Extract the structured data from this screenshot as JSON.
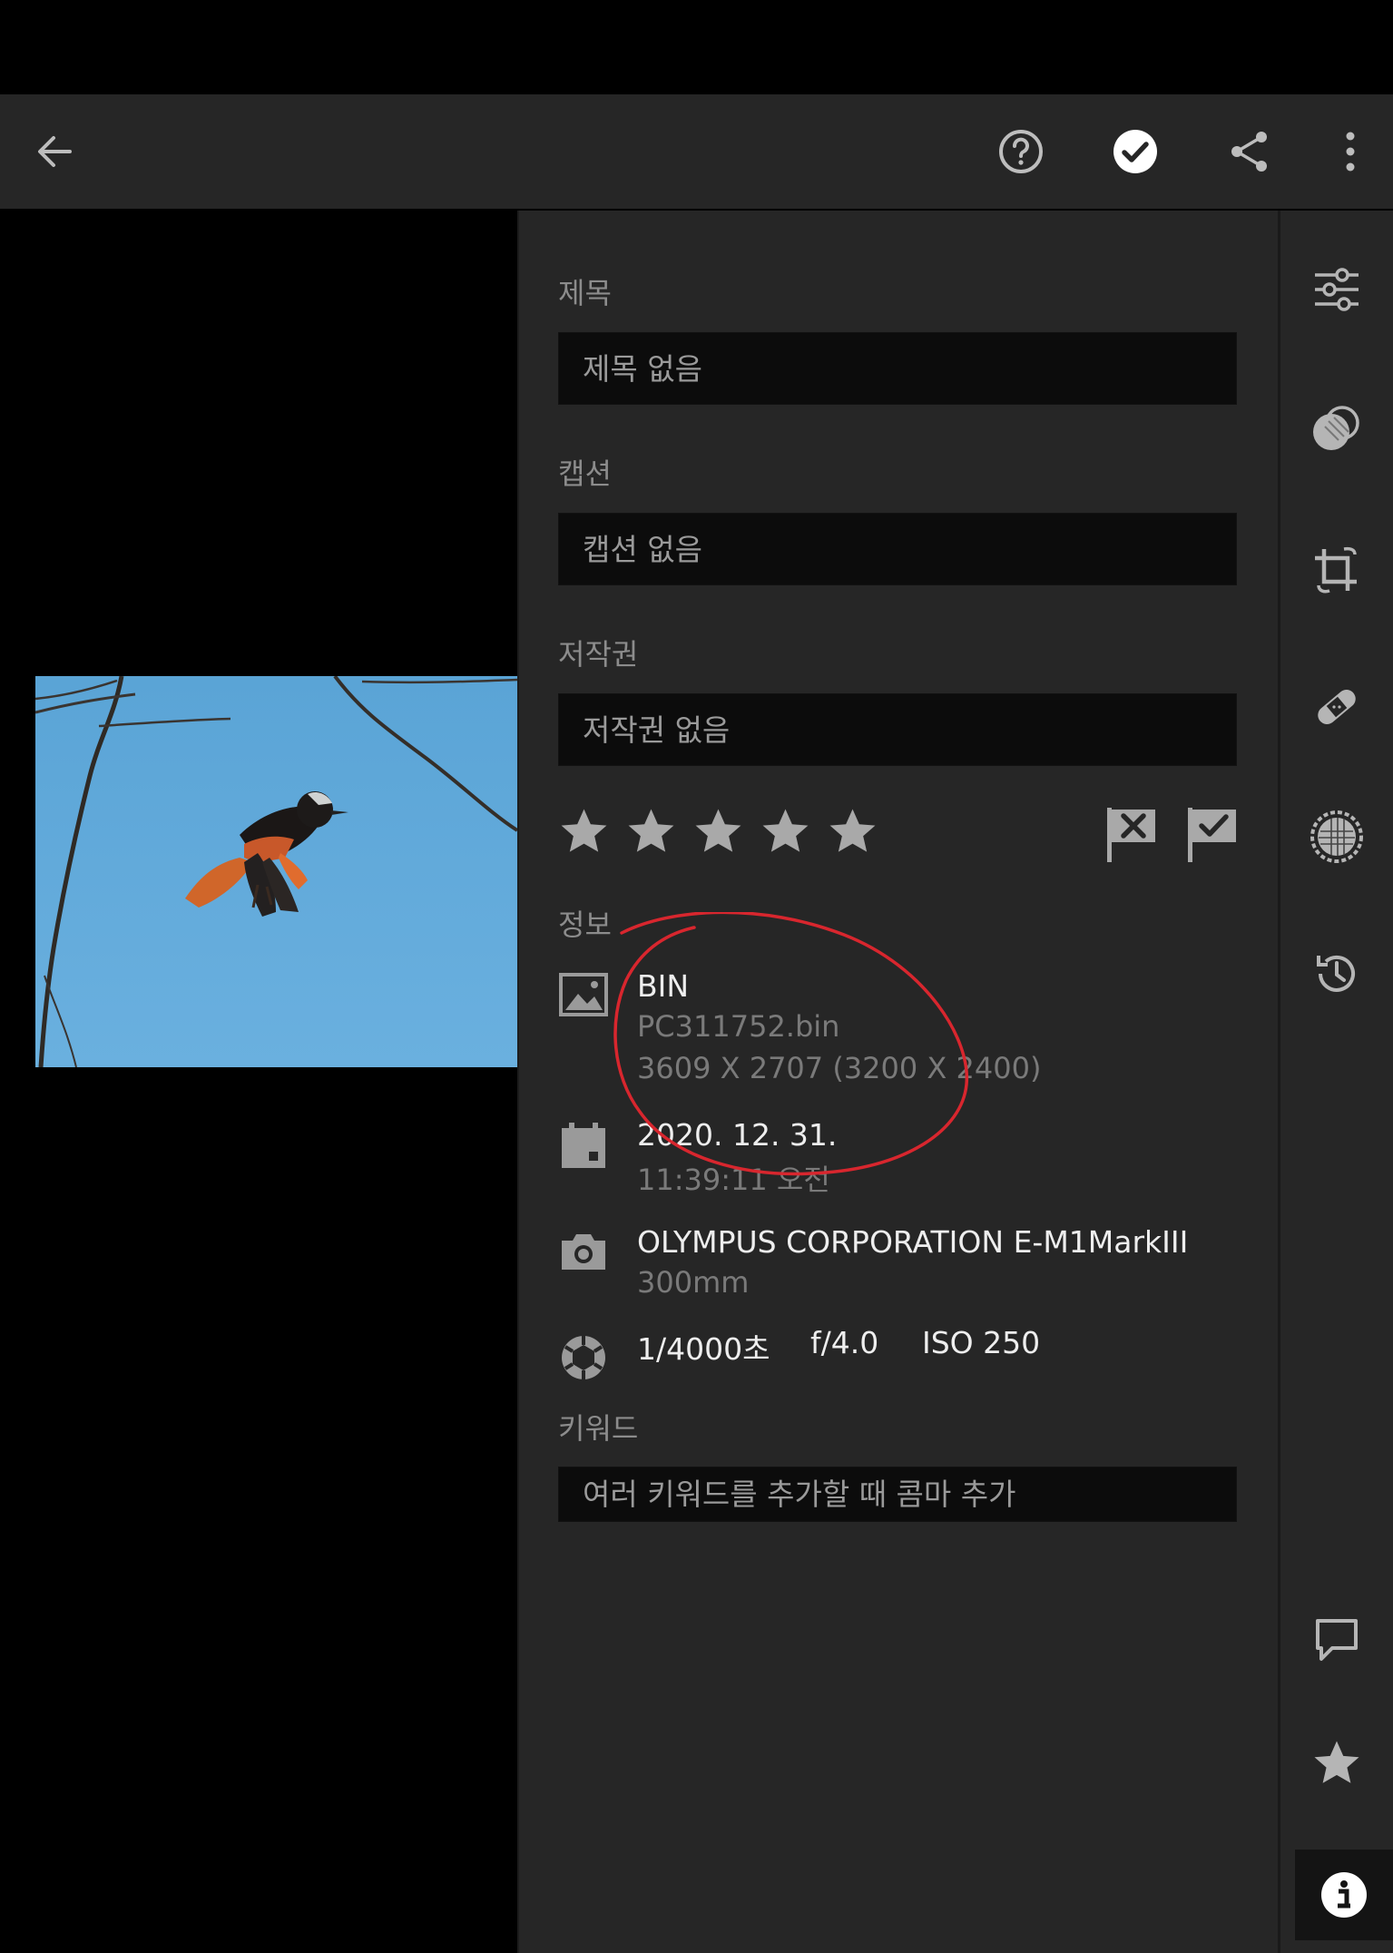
{
  "header": {
    "back_icon": "arrow-left-icon",
    "help_icon": "question-circle-icon",
    "done_icon": "check-circle-icon",
    "share_icon": "share-icon",
    "more_icon": "more-vertical-icon"
  },
  "metadata": {
    "title_label": "제목",
    "title_placeholder": "제목 없음",
    "caption_label": "캡션",
    "caption_placeholder": "캡션 없음",
    "copyright_label": "저작권",
    "copyright_placeholder": "저작권 없음",
    "rating": 0,
    "rating_max": 5,
    "info_label": "정보",
    "file": {
      "type": "BIN",
      "name": "PC311752.bin",
      "dimensions": "3609 X 2707 (3200 X 2400)"
    },
    "date": {
      "date": "2020. 12. 31.",
      "time": "11:39:11 오전"
    },
    "camera": {
      "model": "OLYMPUS CORPORATION E-M1MarkIII",
      "focal_length": "300mm"
    },
    "exposure": {
      "shutter": "1/4000초",
      "aperture": "f/4.0",
      "iso": "ISO 250"
    },
    "keywords_label": "키워드",
    "keywords_placeholder": "여러 키워드를 추가할 때 콤마 추가"
  },
  "tools": [
    "sliders-icon",
    "color-mix-icon",
    "crop-icon",
    "bandage-icon",
    "mask-icon",
    "history-icon",
    "comment-icon",
    "star-icon",
    "info-icon"
  ],
  "colors": {
    "topbar": "#262626",
    "panel": "#262626",
    "field_bg": "#0c0c0c",
    "annotation": "#d8262e"
  }
}
